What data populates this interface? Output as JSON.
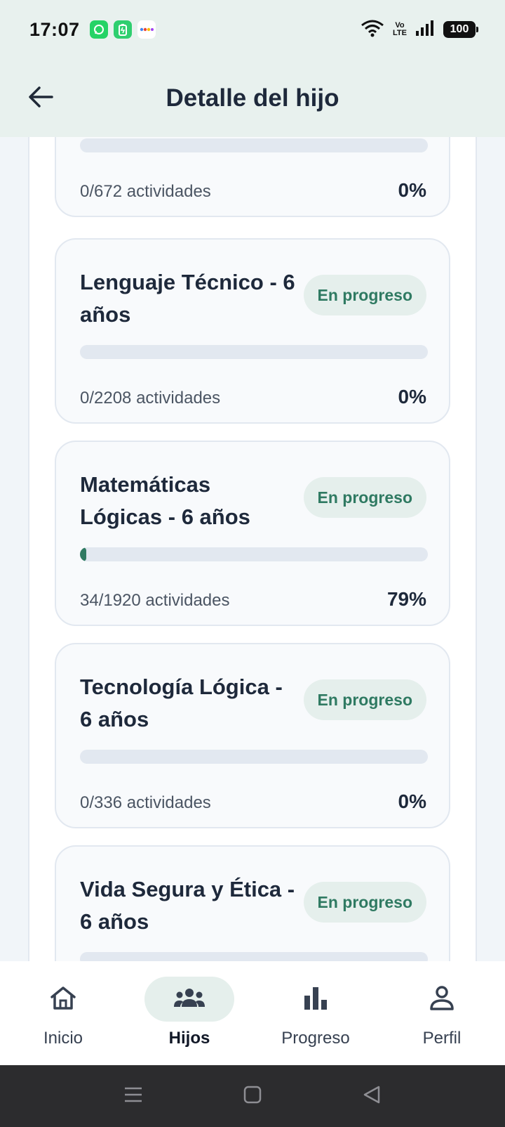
{
  "status_bar": {
    "time": "17:07",
    "battery": "100",
    "volte_top": "Vo",
    "volte_bottom": "LTE"
  },
  "header": {
    "title": "Detalle del hijo",
    "back_icon": "arrow-left-icon"
  },
  "cards": [
    {
      "title": "",
      "badge": "",
      "progress": 0.0,
      "activities": "0/672 actividades",
      "percent": "0%"
    },
    {
      "title": "Lenguaje Técnico - 6 años",
      "badge": "En progreso",
      "progress": 0.0,
      "activities": "0/2208 actividades",
      "percent": "0%"
    },
    {
      "title": "Matemáticas Lógicas - 6 años",
      "badge": "En progreso",
      "progress": 0.018,
      "activities": "34/1920 actividades",
      "percent": "79%"
    },
    {
      "title": "Tecnología Lógica - 6 años",
      "badge": "En progreso",
      "progress": 0.0,
      "activities": "0/336 actividades",
      "percent": "0%"
    },
    {
      "title": "Vida Segura y Ética - 6 años",
      "badge": "En progreso",
      "progress": 0.0,
      "activities": "",
      "percent": ""
    }
  ],
  "bottom_nav": {
    "items": [
      {
        "label": "Inicio",
        "icon": "home-icon"
      },
      {
        "label": "Hijos",
        "icon": "group-icon"
      },
      {
        "label": "Progreso",
        "icon": "bar-chart-icon"
      },
      {
        "label": "Perfil",
        "icon": "person-icon"
      }
    ],
    "active": "Hijos"
  },
  "colors": {
    "accent": "#2f7a62",
    "header_bg": "#e8f1ee",
    "badge_bg": "#e5efec"
  }
}
